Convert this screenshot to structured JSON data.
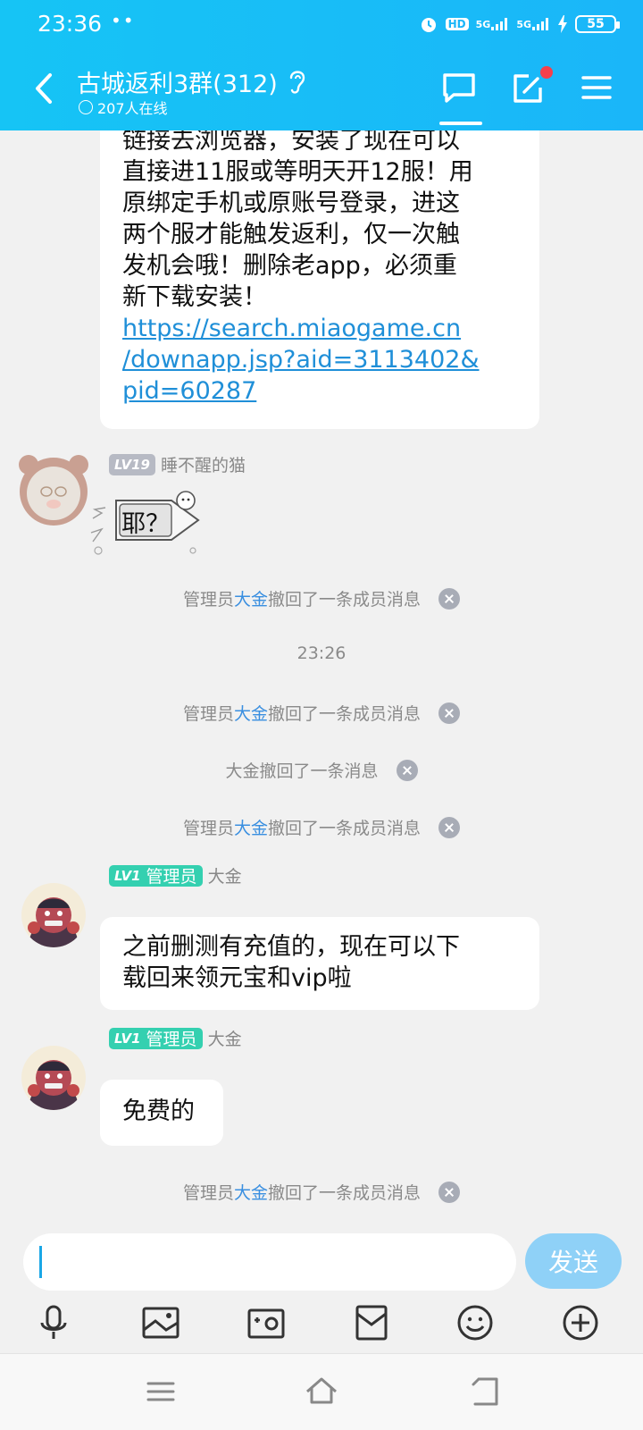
{
  "statusbar": {
    "time": "23:36",
    "dots": "••",
    "signal1": "5G",
    "signal2": "5G",
    "hd": "HD",
    "battery": "55"
  },
  "header": {
    "title": "古城返利3群(312)",
    "online": "207人在线"
  },
  "messages": {
    "m1_text_lines": [
      "链接去浏览器，安装了现在可以",
      "直接进11服或等明天开12服！用",
      "原绑定手机或原账号登录，进这",
      "两个服才能触发返利，仅一次触",
      "发机会哦！删除老app，必须重",
      "新下载安装！"
    ],
    "m1_link_lines": [
      "https://search.miaogame.cn",
      "/downapp.jsp?aid=3113402&",
      "pid=60287"
    ],
    "m2_level": "LV19",
    "m2_sender": "睡不醒的猫",
    "m2_text": "耶？",
    "sys1_prefix": "管理员",
    "sys1_who": "大金",
    "sys1_suffix": "撤回了一条成员消息",
    "timestamp": "23:26",
    "sys2_prefix": "管理员",
    "sys2_who": "大金",
    "sys2_suffix": "撤回了一条成员消息",
    "sys3_text": "大金撤回了一条消息",
    "sys4_prefix": "管理员",
    "sys4_who": "大金",
    "sys4_suffix": "撤回了一条成员消息",
    "m3_level": "LV1",
    "m3_role": "管理员",
    "m3_sender": "大金",
    "m3_lines": [
      "之前删测有充值的，现在可以下",
      "载回来领元宝和vip啦"
    ],
    "m4_level": "LV1",
    "m4_role": "管理员",
    "m4_sender": "大金",
    "m4_text": "免费的",
    "sys5_prefix": "管理员",
    "sys5_who": "大金",
    "sys5_suffix": "撤回了一条成员消息"
  },
  "input": {
    "value": "",
    "send_label": "发送"
  },
  "toolbar_icons": [
    "microphone-icon",
    "image-icon",
    "camera-icon",
    "red-packet-icon",
    "emoji-icon",
    "plus-icon"
  ],
  "colors": {
    "header_bg": "#16c4f5",
    "link": "#1f8fd8",
    "admin_badge": "#34d0b0",
    "send_button": "#8fd1f7"
  }
}
